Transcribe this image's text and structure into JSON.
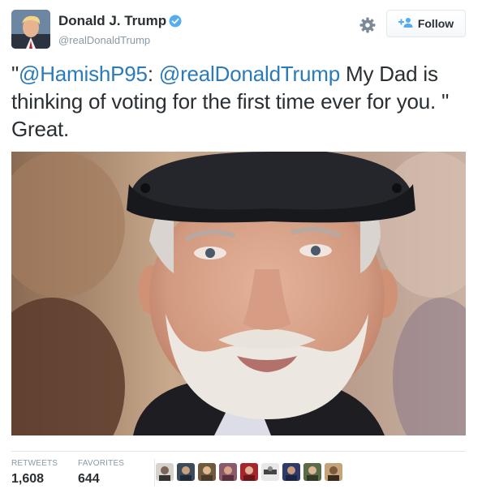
{
  "user": {
    "full_name": "Donald J. Trump",
    "handle": "@realDonaldTrump",
    "verified": true
  },
  "actions": {
    "settings_icon": "gear-icon",
    "follow_label": "Follow",
    "follow_icon": "add-user-icon"
  },
  "tweet": {
    "quote_open": "\"",
    "mention_1": "@HamishP95",
    "colon": ": ",
    "mention_2": "@realDonaldTrump",
    "body": " My Dad is thinking of voting for the first time ever for you. \" Great."
  },
  "stats": {
    "retweets_label": "RETWEETS",
    "retweets_value": "1,608",
    "favorites_label": "FAVORITES",
    "favorites_value": "644"
  },
  "colors": {
    "link": "#2b7bb9",
    "verified": "#55acee",
    "muted": "#8899a6",
    "text": "#292f33"
  }
}
